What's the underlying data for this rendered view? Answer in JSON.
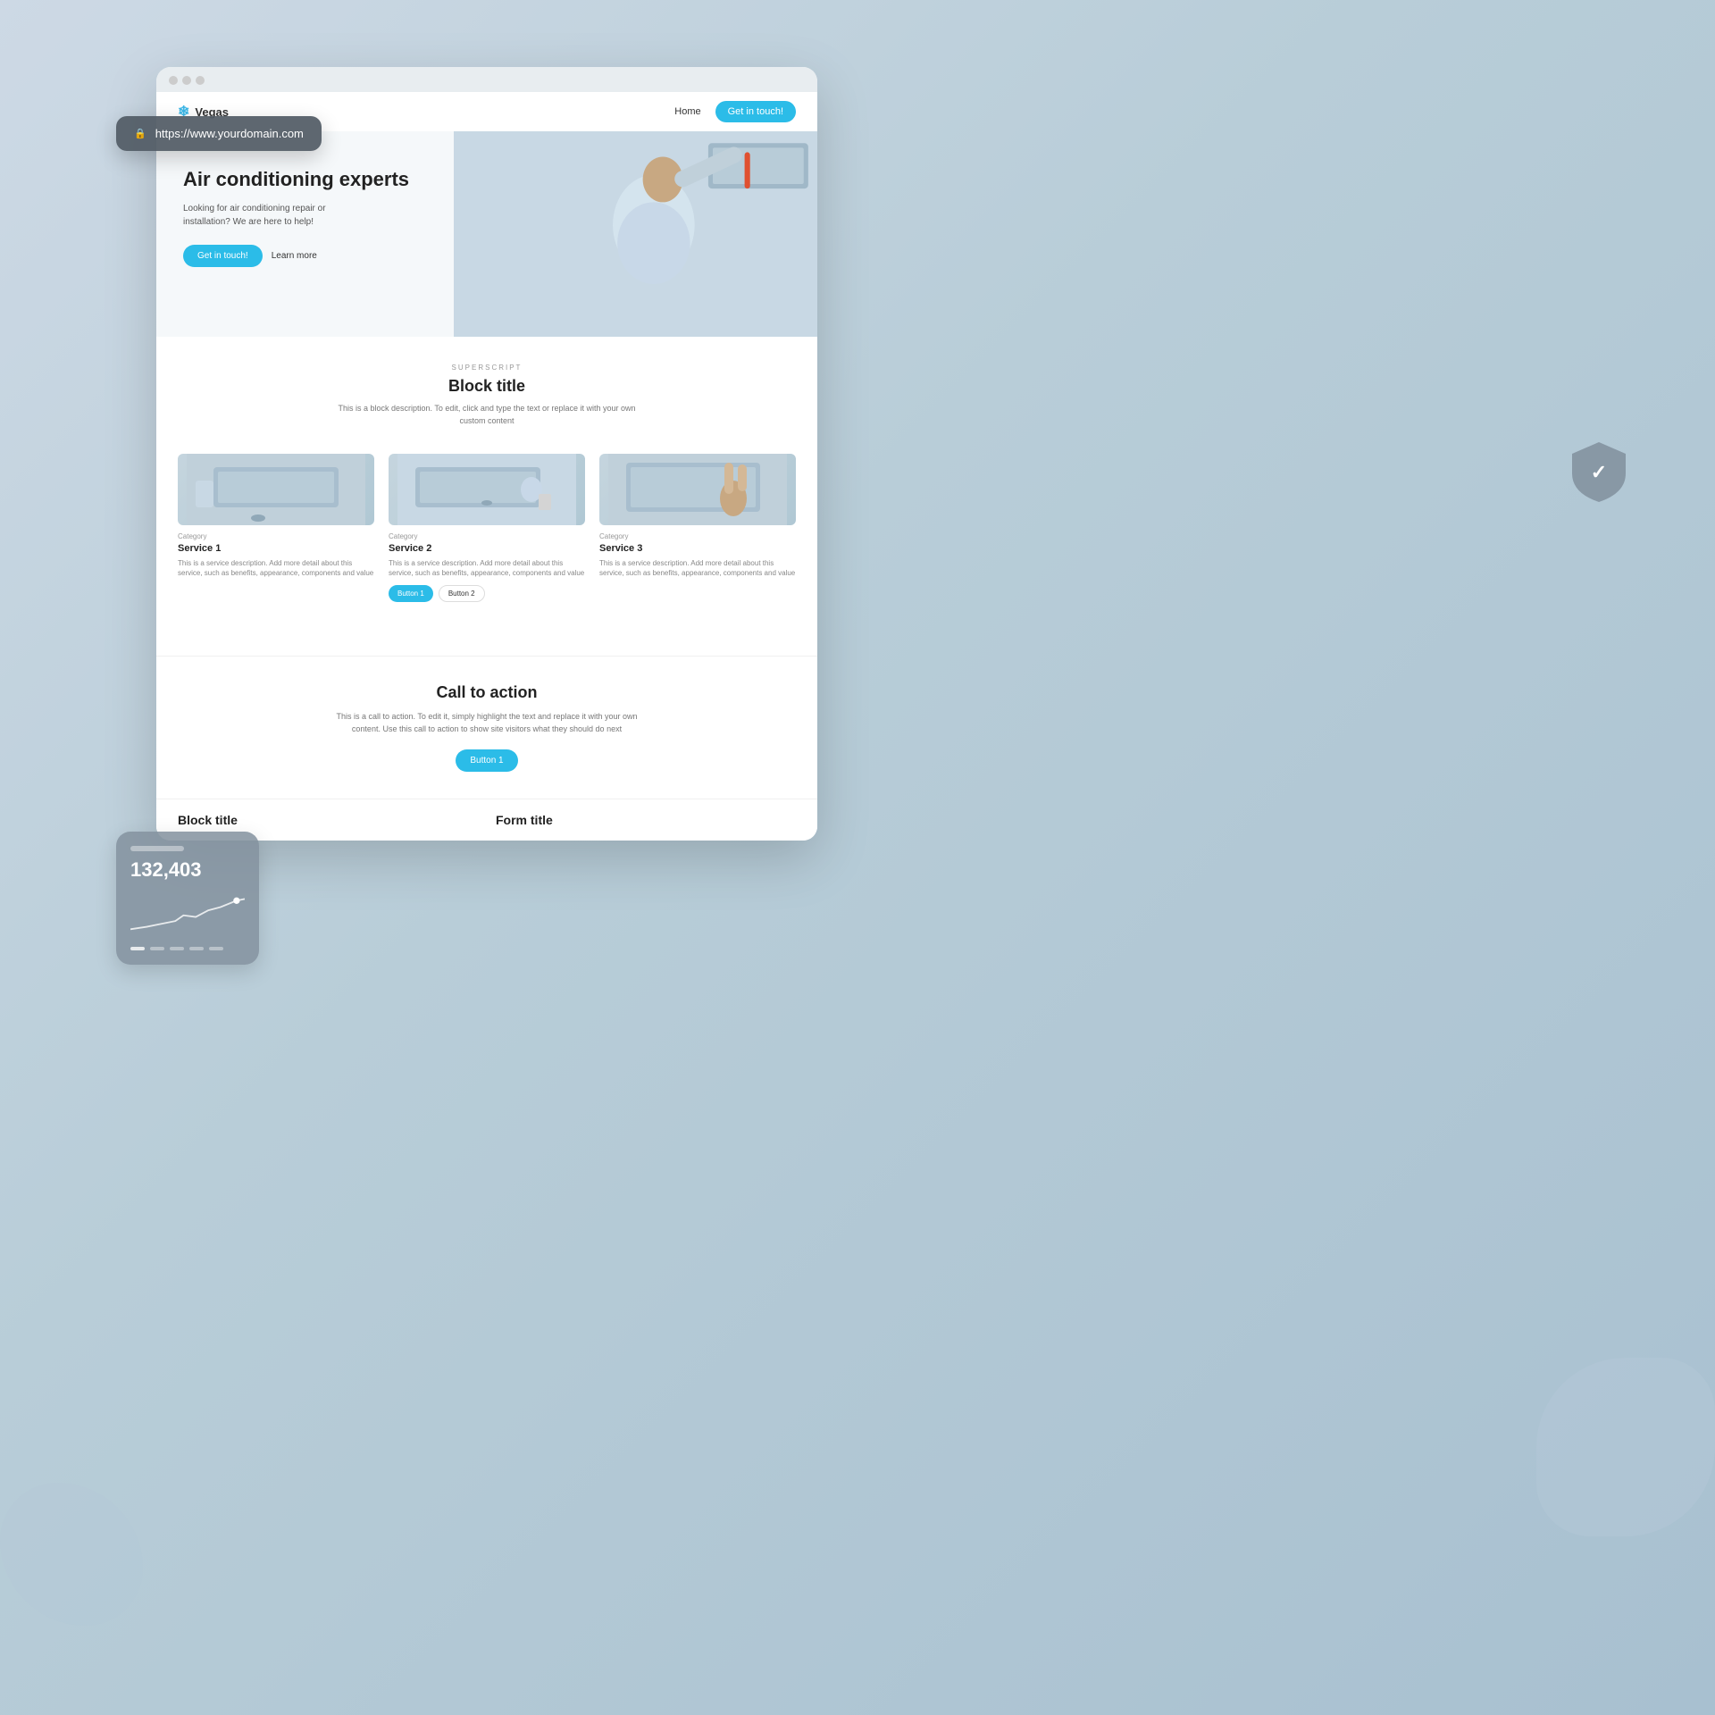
{
  "background": {
    "color": "#cdd9e5"
  },
  "url_bar": {
    "url": "https://www.yourdomain.com",
    "lock_icon": "🔒"
  },
  "browser": {
    "logo": "Vegas",
    "logo_icon": "❄"
  },
  "nav": {
    "home_link": "Home",
    "cta_button": "Get in touch!"
  },
  "hero": {
    "title": "Air conditioning experts",
    "subtitle": "Looking for air conditioning repair or installation? We are here to help!",
    "btn_primary": "Get in touch!",
    "btn_secondary": "Learn more"
  },
  "block_section": {
    "superscript": "SUPERSCRIPT",
    "title": "Block title",
    "description": "This is a block description. To edit, click and type the text or replace it with your own custom content"
  },
  "services": [
    {
      "category": "Category",
      "name": "Service 1",
      "description": "This is a service description. Add more detail about this service, such as benefits, appearance, components and value"
    },
    {
      "category": "Category",
      "name": "Service 2",
      "description": "This is a service description. Add more detail about this service, such as benefits, appearance, components and value",
      "btn1": "Button 1",
      "btn2": "Button 2"
    },
    {
      "category": "Category",
      "name": "Service 3",
      "description": "This is a service description. Add more detail about this service, such as benefits, appearance, components and value"
    }
  ],
  "cta": {
    "title": "Call to action",
    "description": "This is a call to action. To edit it, simply highlight the text and replace it with your own content. Use this call to action to show site visitors what they should do next",
    "button": "Button 1"
  },
  "bottom": {
    "block_title": "Block title",
    "form_title": "Form title"
  },
  "stats": {
    "number": "132,403"
  },
  "security_badge": {
    "checkmark": "✓"
  }
}
